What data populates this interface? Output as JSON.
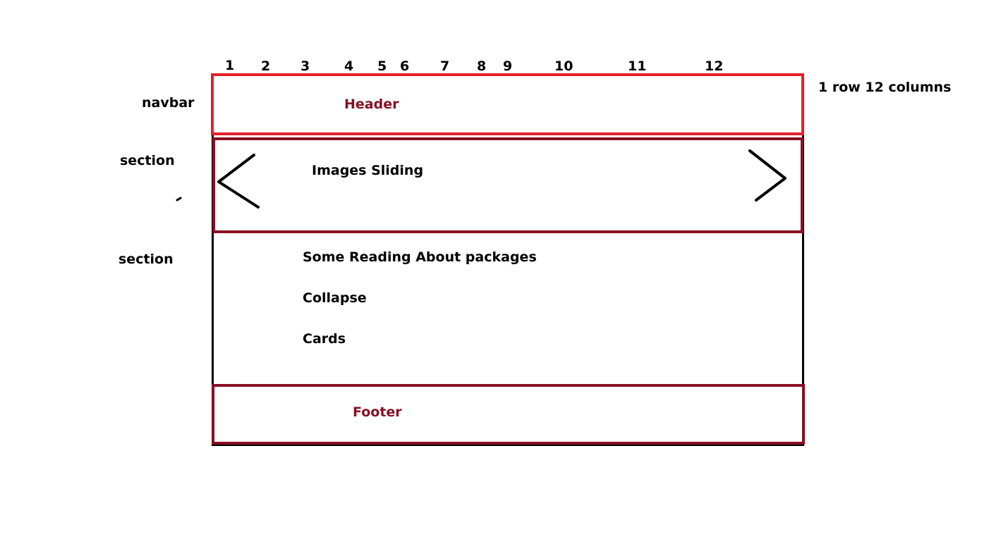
{
  "columns": [
    "1",
    "2",
    "3",
    "4",
    "5",
    "6",
    "7",
    "8",
    "9",
    "10",
    "11",
    "12"
  ],
  "grid_note": "1 row 12 columns",
  "side_labels": {
    "navbar": "navbar",
    "section_1": "section",
    "section_2": "section"
  },
  "header": {
    "label": "Header"
  },
  "slider": {
    "label": "Images Sliding",
    "prev_arrow_icon": "chevron-left-icon",
    "next_arrow_icon": "chevron-right-icon"
  },
  "content": {
    "items": [
      "Some Reading About packages",
      "Collapse",
      "Cards"
    ]
  },
  "footer": {
    "label": "Footer"
  },
  "colors": {
    "header_border": "#e5202b",
    "section_border": "#880f23",
    "header_text": "#880f23",
    "footer_text": "#880f23",
    "ink": "#000000"
  }
}
